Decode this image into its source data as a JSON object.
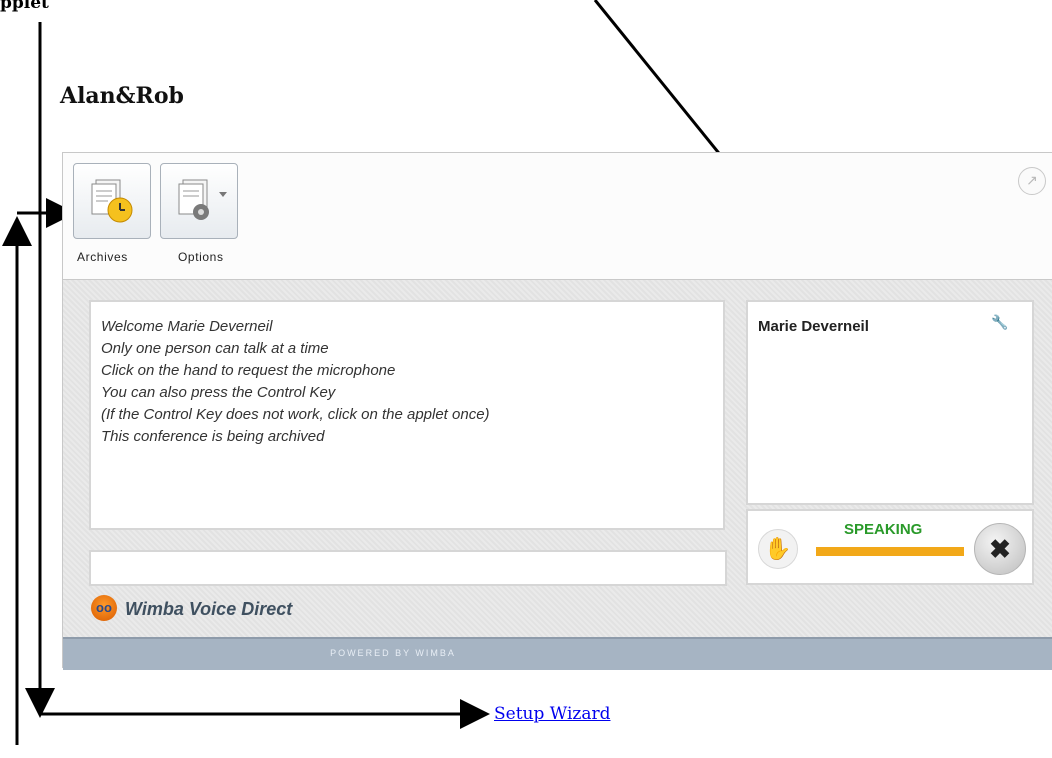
{
  "annotation": {
    "cut_title": "pplet"
  },
  "page": {
    "heading": "Alan&Rob",
    "setup_link": "Setup Wizard"
  },
  "toolbar": {
    "archives_label": "Archives",
    "options_label": "Options",
    "archives_icon": "archive-clock-icon",
    "options_icon": "settings-doc-icon",
    "popout_icon": "popout-arrow-icon"
  },
  "chat": {
    "lines": [
      "Welcome Marie Deverneil",
      "Only one person can talk at a time",
      "Click on the hand to request the microphone",
      "You can also press the Control Key",
      "(If the Control Key does not work, click on the applet once)",
      "This conference is being archived"
    ],
    "input_value": ""
  },
  "participants": {
    "name": "Marie Deverneil",
    "icon": "key-icon"
  },
  "controls": {
    "status": "SPEAKING",
    "level": 1.0,
    "hand_icon": "raise-hand-icon",
    "cancel_icon": "close-icon",
    "status_color": "#2a9a2a",
    "level_color": "#f2a818"
  },
  "brand": {
    "name": "Wimba Voice Direct",
    "footer": "POWERED BY WIMBA"
  }
}
